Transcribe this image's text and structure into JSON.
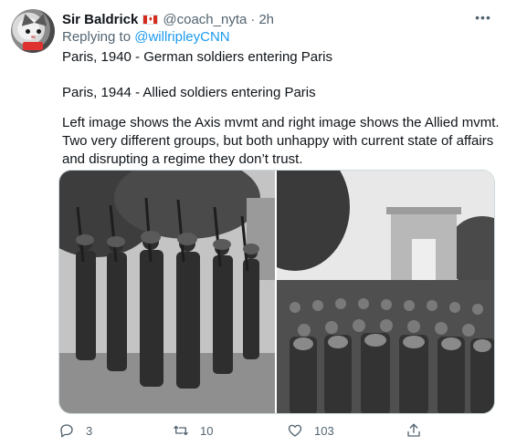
{
  "tweet": {
    "display_name": "Sir Baldrick",
    "flag_icon": "canada-flag-icon",
    "handle": "@coach_nyta",
    "separator": "·",
    "time": "2h",
    "more_icon": "more-horizontal-icon",
    "replying_prefix": "Replying to",
    "replying_to": "@willripleyCNN",
    "paragraphs": [
      "Paris, 1940 - German soldiers entering Paris",
      "Paris, 1944 - Allied soldiers entering Paris",
      "Left image shows the Axis mvmt and right image shows the Allied mvmt. Two very different groups, but both unhappy with current state of affairs and disrupting a regime they don’t trust."
    ]
  },
  "actions": {
    "reply": {
      "icon": "reply-icon",
      "count": "3"
    },
    "retweet": {
      "icon": "retweet-icon",
      "count": "10"
    },
    "like": {
      "icon": "heart-icon",
      "count": "103"
    },
    "share": {
      "icon": "share-icon"
    }
  },
  "colors": {
    "text": "#0f1419",
    "secondary": "#536471",
    "link": "#1d9bf0",
    "border": "#cfd9de"
  }
}
